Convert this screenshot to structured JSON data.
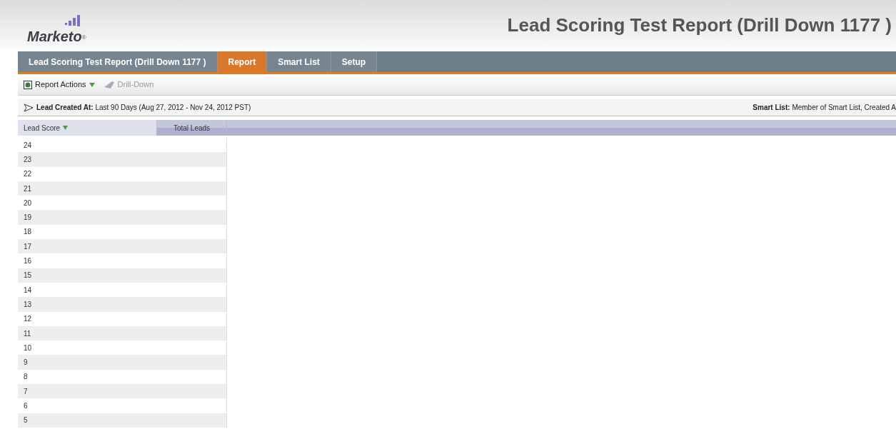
{
  "header": {
    "logo": "Marketo",
    "logo_mark": "®",
    "title": "Lead Scoring Test Report (Drill Down 1177 )"
  },
  "tabs": [
    {
      "label": "Lead Scoring Test Report (Drill Down 1177 )",
      "selected": false
    },
    {
      "label": "Report",
      "selected": true
    },
    {
      "label": "Smart List",
      "selected": false
    },
    {
      "label": "Setup",
      "selected": false
    }
  ],
  "toolbar": [
    {
      "label": "Report Actions",
      "disabled": false,
      "kind": "menu"
    },
    {
      "label": "Drill-Down",
      "disabled": true,
      "kind": "action"
    }
  ],
  "filter": {
    "label": "Lead Created At:",
    "value": "Last 90 Days (Aug 27, 2012 - Nov 24, 2012 PST)",
    "smart_list_label": "Smart List:",
    "smart_list_value": "Member of Smart List, Created A"
  },
  "table": {
    "columns": [
      "Lead Score",
      "Total Leads"
    ],
    "rows": [
      "24",
      "23",
      "22",
      "21",
      "20",
      "19",
      "18",
      "17",
      "16",
      "15",
      "14",
      "13",
      "12",
      "11",
      "10",
      "9",
      "8",
      "7",
      "6",
      "5"
    ]
  }
}
